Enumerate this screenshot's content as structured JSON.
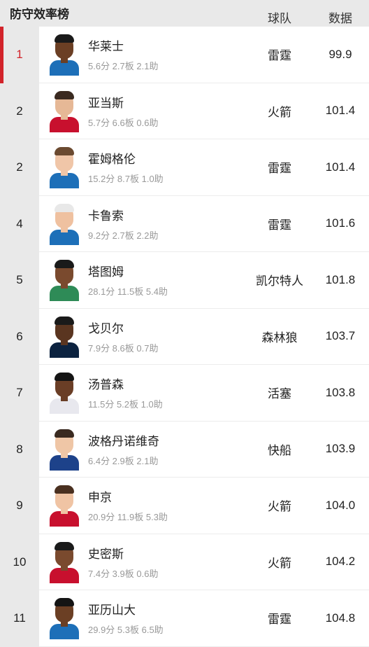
{
  "header": {
    "title": "防守效率榜",
    "col_team": "球队",
    "col_value": "数据"
  },
  "accent_color": "#d2232a",
  "rows": [
    {
      "rank": "1",
      "name": "华莱士",
      "stats": "5.6分 2.7板 2.1助",
      "team": "雷霆",
      "value": "99.9",
      "jersey": "#1d6fb8",
      "skin": "#6b3f24",
      "hair": "#1a1a1a"
    },
    {
      "rank": "2",
      "name": "亚当斯",
      "stats": "5.7分 6.6板 0.6助",
      "team": "火箭",
      "value": "101.4",
      "jersey": "#c8102e",
      "skin": "#e6b896",
      "hair": "#3a2a20"
    },
    {
      "rank": "2",
      "name": "霍姆格伦",
      "stats": "15.2分 8.7板 1.0助",
      "team": "雷霆",
      "value": "101.4",
      "jersey": "#1d6fb8",
      "skin": "#f0c6a8",
      "hair": "#6b4a30"
    },
    {
      "rank": "4",
      "name": "卡鲁索",
      "stats": "9.2分 2.7板 2.2助",
      "team": "雷霆",
      "value": "101.6",
      "jersey": "#1d6fb8",
      "skin": "#efc1a0",
      "hair": "#e8e8e8"
    },
    {
      "rank": "5",
      "name": "塔图姆",
      "stats": "28.1分 11.5板 5.4助",
      "team": "凯尔特人",
      "value": "101.8",
      "jersey": "#2e8b57",
      "skin": "#7a4a2e",
      "hair": "#1a1a1a"
    },
    {
      "rank": "6",
      "name": "戈贝尔",
      "stats": "7.9分 8.6板 0.7助",
      "team": "森林狼",
      "value": "103.7",
      "jersey": "#0c2340",
      "skin": "#5a3520",
      "hair": "#1a1a1a"
    },
    {
      "rank": "7",
      "name": "汤普森",
      "stats": "11.5分 5.2板 1.0助",
      "team": "活塞",
      "value": "103.8",
      "jersey": "#e8e8ee",
      "skin": "#6a3e26",
      "hair": "#141414"
    },
    {
      "rank": "8",
      "name": "波格丹诺维奇",
      "stats": "6.4分 2.9板 2.1助",
      "team": "快船",
      "value": "103.9",
      "jersey": "#1d428a",
      "skin": "#efc6a6",
      "hair": "#3a2a20"
    },
    {
      "rank": "9",
      "name": "申京",
      "stats": "20.9分 11.9板 5.3助",
      "team": "火箭",
      "value": "104.0",
      "jersey": "#c8102e",
      "skin": "#f0c4a4",
      "hair": "#4a3020"
    },
    {
      "rank": "10",
      "name": "史密斯",
      "stats": "7.4分 3.9板 0.6助",
      "team": "火箭",
      "value": "104.2",
      "jersey": "#c8102e",
      "skin": "#7a4a2e",
      "hair": "#1a1a1a"
    },
    {
      "rank": "11",
      "name": "亚历山大",
      "stats": "29.9分 5.3板 6.5助",
      "team": "雷霆",
      "value": "104.8",
      "jersey": "#1d6fb8",
      "skin": "#6b3f24",
      "hair": "#141414"
    }
  ]
}
